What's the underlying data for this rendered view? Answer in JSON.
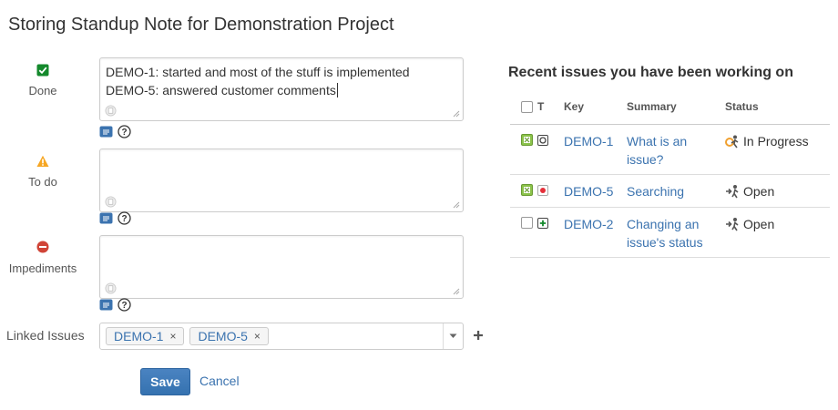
{
  "page": {
    "title": "Storing Standup Note for Demonstration Project"
  },
  "form": {
    "done": {
      "label": "Done",
      "icon": "check-icon",
      "lines": [
        "DEMO-1: started and most of the stuff is implemented",
        "DEMO-5: answered customer comments"
      ]
    },
    "todo": {
      "label": "To do",
      "icon": "warning-icon",
      "lines": []
    },
    "impediments": {
      "label": "Impediments",
      "icon": "blocked-icon",
      "lines": []
    },
    "linked_issues": {
      "label": "Linked Issues",
      "chips": [
        "DEMO-1",
        "DEMO-5"
      ],
      "chip_remove": "×"
    },
    "save_label": "Save",
    "cancel_label": "Cancel"
  },
  "recent": {
    "title": "Recent issues you have been working on",
    "columns": [
      "T",
      "Key",
      "Summary",
      "Status"
    ],
    "rows": [
      {
        "checked": true,
        "type_icon": "task-icon",
        "key": "DEMO-1",
        "summary": [
          "What is an",
          "issue?"
        ],
        "status": "In Progress",
        "status_icon": "in-progress-icon"
      },
      {
        "checked": true,
        "type_icon": "bug-icon",
        "key": "DEMO-5",
        "summary": [
          "Searching"
        ],
        "status": "Open",
        "status_icon": "open-icon"
      },
      {
        "checked": false,
        "type_icon": "improvement-icon",
        "key": "DEMO-2",
        "summary": [
          "Changing an",
          "issue's status"
        ],
        "status": "Open",
        "status_icon": "open-icon"
      }
    ]
  },
  "colors": {
    "link": "#3b73af",
    "primary_button": "#3572b0",
    "done_icon": "#14892c",
    "todo_icon": "#f6a623",
    "impediment_icon": "#d04437"
  }
}
